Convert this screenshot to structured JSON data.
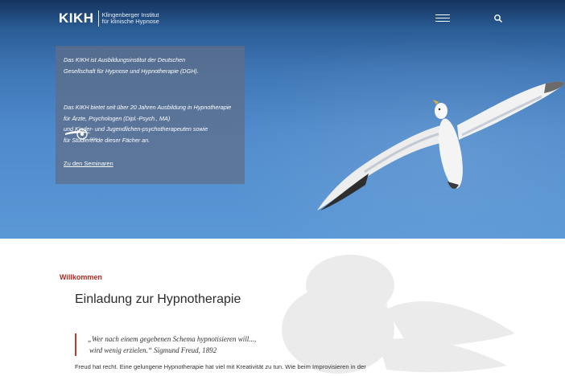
{
  "header": {
    "logo": "KIKH",
    "logo_sub_line1": "Klingenberger Institut",
    "logo_sub_line2": "für klinische Hypnose",
    "menu_icon": "hamburger-icon",
    "search_icon": "search-icon"
  },
  "hero": {
    "paragraph1": "Das KIKH ist Ausbildungsinstitut der Deutschen\nGesellschaft für Hypnose und Hypnotherapie (DGH).",
    "dgh_logo_text": "DGH",
    "paragraph2": "Das KIKH bietet seit über 20 Jahren Ausbildung in Hypnotherapie\nfür Ärzte, Psychologen (Dipl.-Psych., MA)\nund Kinder- und Jugendlichen-psychotherapeuten sowie\nfür Studierende dieser Fächer an.",
    "link": "Zu den Seminaren"
  },
  "main": {
    "kicker": "Willkommen",
    "title": "Einladung zur Hypnotherapie",
    "quote_line1": "„Wer nach einem gegebenen Schema hypnotisieren will...,",
    "quote_line2": "wird wenig erzielen.“ Sigmund Freud, 1892",
    "body": "Freud hat recht. Eine gelungene Hypnotherapie hat viel mit Kreativität zu tun. Wie beim Improvisieren in der"
  },
  "colors": {
    "accent": "#b2281f",
    "sky_top": "#15345e",
    "sky_bottom": "#5b98d6"
  }
}
